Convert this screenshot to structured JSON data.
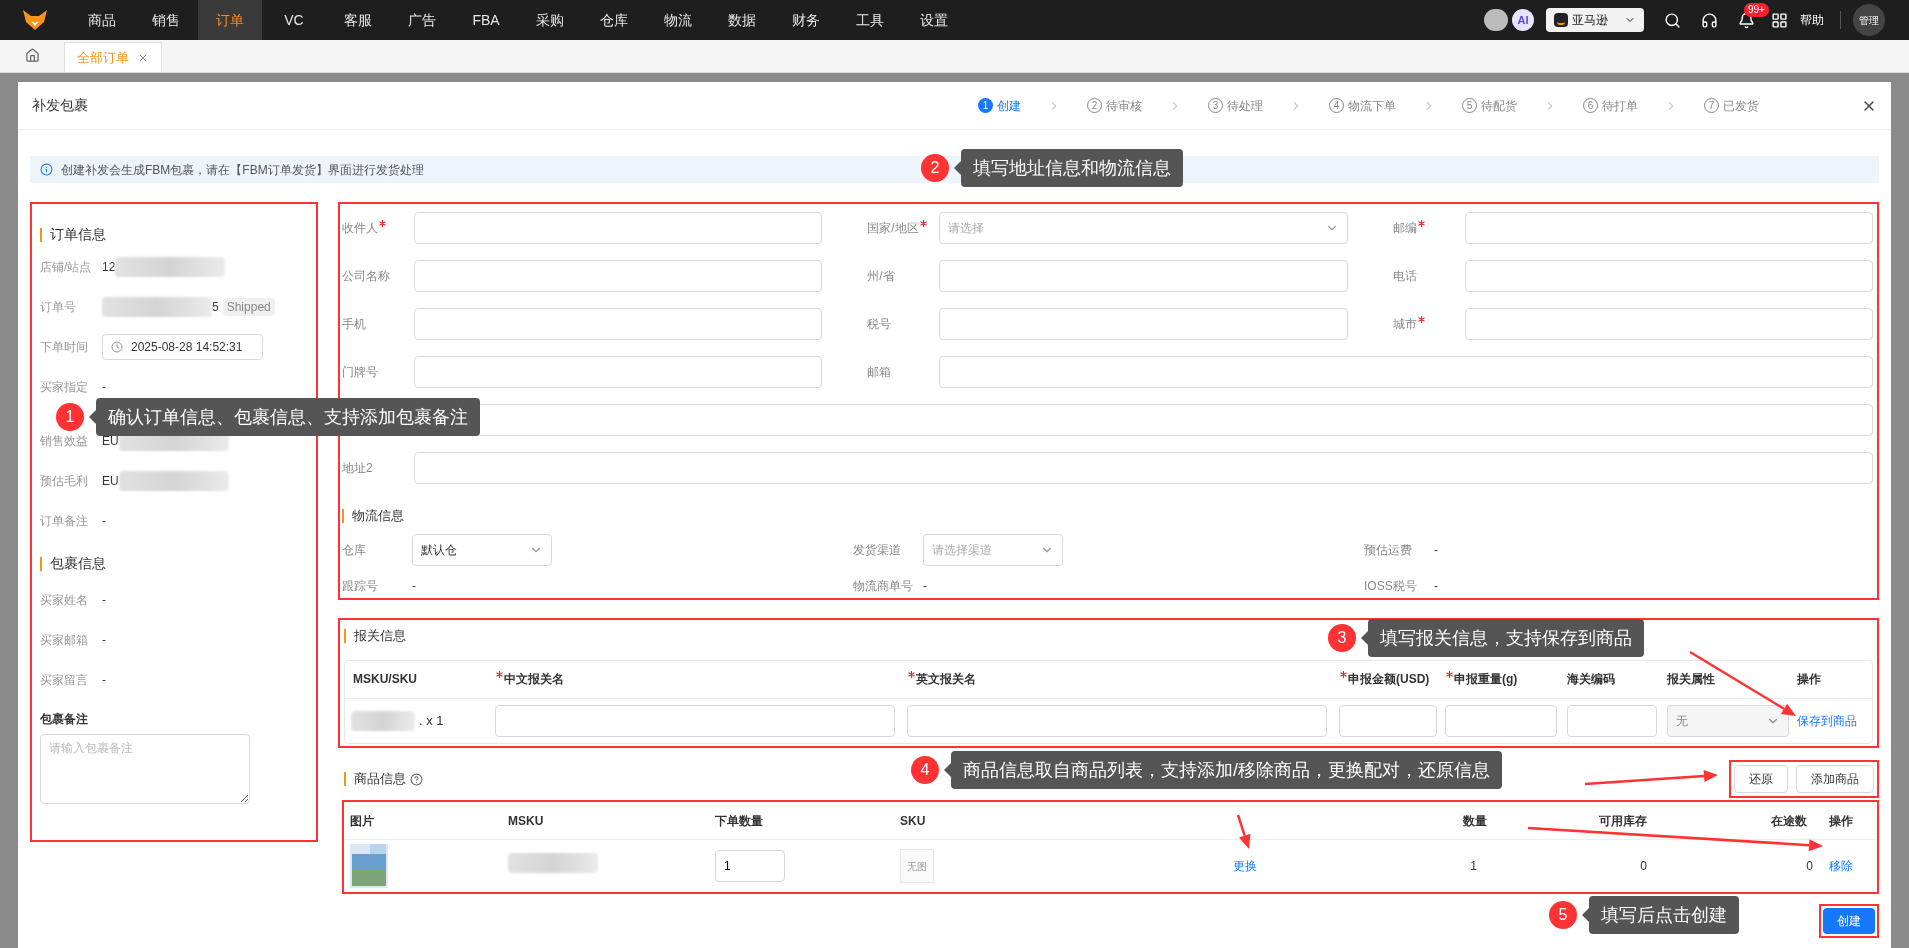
{
  "nav": {
    "items": [
      {
        "label": "商品",
        "selected": false
      },
      {
        "label": "销售",
        "selected": false
      },
      {
        "label": "订单",
        "selected": true
      },
      {
        "label": "VC",
        "selected": false
      },
      {
        "label": "客服",
        "selected": false
      },
      {
        "label": "广告",
        "selected": false
      },
      {
        "label": "FBA",
        "selected": false
      },
      {
        "label": "采购",
        "selected": false
      },
      {
        "label": "仓库",
        "selected": false
      },
      {
        "label": "物流",
        "selected": false
      },
      {
        "label": "数据",
        "selected": false
      },
      {
        "label": "财务",
        "selected": false
      },
      {
        "label": "工具",
        "selected": false
      },
      {
        "label": "设置",
        "selected": false
      }
    ],
    "ai": "AI",
    "marketplace": "亚马逊",
    "notifications": "99+",
    "help": "帮助",
    "user": "管理"
  },
  "tabs": [
    {
      "label": "全部订单",
      "selected": true
    }
  ],
  "modal": {
    "title": "补发包裹",
    "steps": [
      {
        "number": "1",
        "label": "创建",
        "selected": true
      },
      {
        "number": "2",
        "label": "待审核",
        "selected": false
      },
      {
        "number": "3",
        "label": "待处理",
        "selected": false
      },
      {
        "number": "4",
        "label": "物流下单",
        "selected": false
      },
      {
        "number": "5",
        "label": "待配货",
        "selected": false
      },
      {
        "number": "6",
        "label": "待打单",
        "selected": false
      },
      {
        "number": "7",
        "label": "已发货",
        "selected": false
      }
    ],
    "notice": "创建补发会生成FBM包裹，请在【FBM订单发货】界面进行发货处理",
    "order_info": {
      "title": "订单信息",
      "fields": [
        {
          "label": "店铺/站点",
          "kind": "masked",
          "value": "12"
        },
        {
          "label": "订单号",
          "kind": "masked_end",
          "value": "5",
          "tag": "Shipped"
        },
        {
          "label": "下单时间",
          "kind": "datetime",
          "value": "2025-08-28 14:52:31"
        },
        {
          "label": "买家指定",
          "kind": "text",
          "value": "-"
        },
        {
          "label": "销售效益",
          "kind": "masked",
          "value": "EU"
        },
        {
          "label": "预估毛利",
          "kind": "masked",
          "value": "EU"
        },
        {
          "label": "订单备注",
          "kind": "text",
          "value": "-"
        }
      ]
    },
    "package_info": {
      "title": "包裹信息",
      "fields": [
        {
          "label": "买家姓名",
          "kind": "text",
          "value": "-"
        },
        {
          "label": "买家邮箱",
          "kind": "text",
          "value": "-"
        },
        {
          "label": "买家留言",
          "kind": "text",
          "value": "-"
        }
      ],
      "note": {
        "label": "包裹备注",
        "placeholder": "请输入包裹备注"
      }
    },
    "address": {
      "fields": [
        {
          "label": "收件人",
          "required": true,
          "kind": "input"
        },
        {
          "label": "国家/地区",
          "required": true,
          "kind": "select",
          "placeholder": "请选择"
        },
        {
          "label": "邮编",
          "required": true,
          "kind": "input"
        },
        {
          "label": "公司名称",
          "required": false,
          "kind": "input"
        },
        {
          "label": "州/省",
          "required": false,
          "kind": "input"
        },
        {
          "label": "电话",
          "required": false,
          "kind": "input"
        },
        {
          "label": "手机",
          "required": false,
          "kind": "input"
        },
        {
          "label": "税号",
          "required": false,
          "kind": "input"
        },
        {
          "label": "城市",
          "required": true,
          "kind": "input"
        },
        {
          "label": "门牌号",
          "required": false,
          "kind": "input"
        },
        {
          "label": "邮箱",
          "required": false,
          "kind": "wide"
        },
        {
          "required": false,
          "kind": "full"
        },
        {
          "label": "地址2",
          "required": false,
          "kind": "full"
        }
      ]
    },
    "logistics": {
      "title": "物流信息",
      "fields": [
        {
          "label": "仓库",
          "kind": "select",
          "value": "默认仓"
        },
        {
          "label": "发货渠道",
          "kind": "select",
          "placeholder": "请选择渠道"
        },
        {
          "label": "预估运费",
          "kind": "text",
          "value": "-"
        },
        {
          "label": "跟踪号",
          "kind": "text",
          "value": "-"
        },
        {
          "label": "物流商单号",
          "kind": "text",
          "value": "-"
        },
        {
          "label": "IOSS税号",
          "kind": "text",
          "value": "-"
        }
      ]
    },
    "customs": {
      "title": "报关信息",
      "columns": [
        {
          "label": "MSKU/SKU",
          "required": false
        },
        {
          "label": "中文报关名",
          "required": true
        },
        {
          "label": "英文报关名",
          "required": true
        },
        {
          "label": "申报金额(USD)",
          "required": true
        },
        {
          "label": "申报重量(g)",
          "required": true
        },
        {
          "label": "海关编码",
          "required": false
        },
        {
          "label": "报关属性",
          "required": false
        },
        {
          "label": "操作",
          "required": false
        }
      ],
      "rows": [
        {
          "quantity": ". x 1",
          "attribute": {
            "value": "无",
            "disabled": true
          },
          "action": "保存到商品"
        }
      ]
    },
    "products": {
      "title": "商品信息",
      "buttons": [
        "还原",
        "添加商品"
      ],
      "columns": [
        "图片",
        "MSKU",
        "下单数量",
        "SKU",
        "数量",
        "可用库存",
        "在途数",
        "操作"
      ],
      "rows": [
        {
          "order_quantity": "1",
          "sku_image": "无图",
          "swap": "更换",
          "quantity": "1",
          "available": "0",
          "in_transit": "0",
          "action": "移除"
        }
      ]
    },
    "create_button": "创建"
  },
  "annotations": [
    {
      "number": "1",
      "text": "确认订单信息、包裹信息、支持添加包裹备注"
    },
    {
      "number": "2",
      "text": "填写地址信息和物流信息"
    },
    {
      "number": "3",
      "text": "填写报关信息，支持保存到商品"
    },
    {
      "number": "4",
      "text": "商品信息取自商品列表，支持添加/移除商品，更换配对，还原信息"
    },
    {
      "number": "5",
      "text": "填写后点击创建"
    }
  ]
}
